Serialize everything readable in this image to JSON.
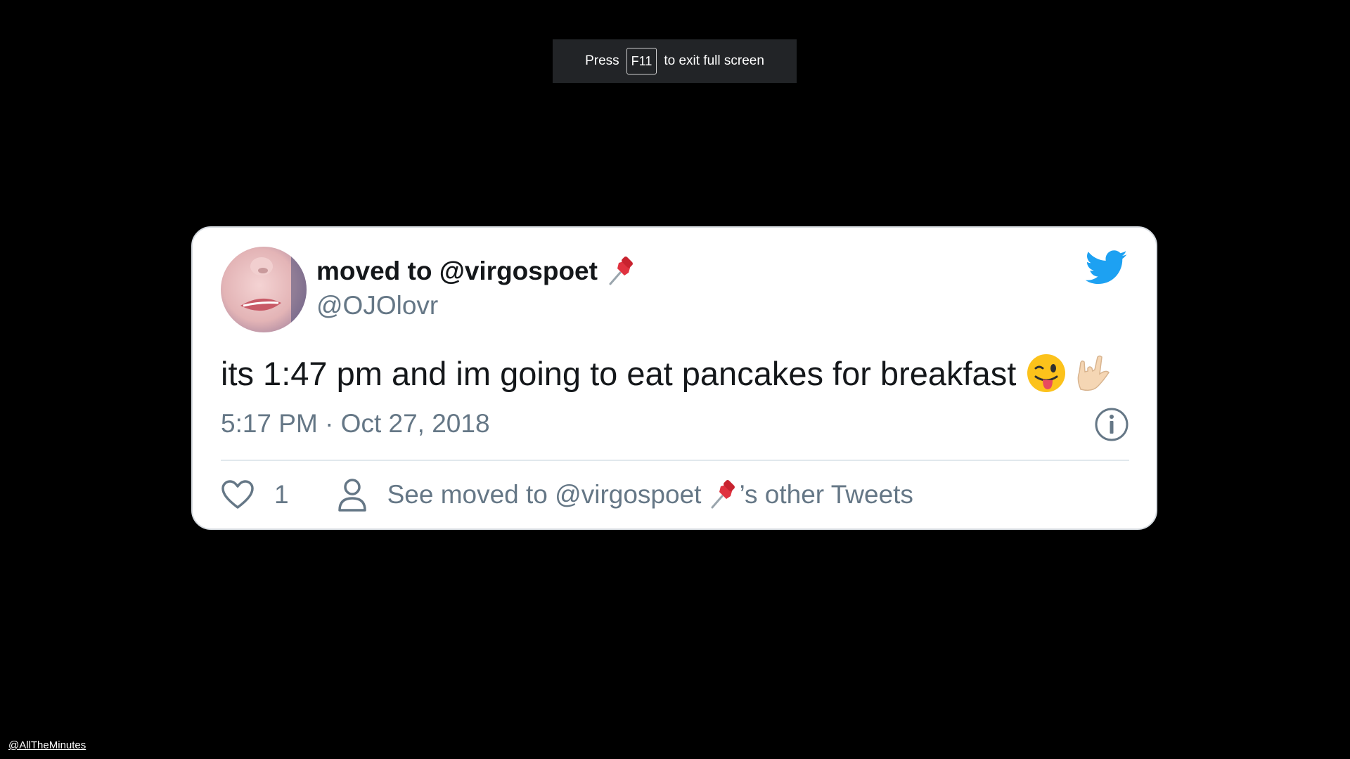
{
  "fullscreen_notice": {
    "prefix": "Press",
    "key": "F11",
    "suffix": "to exit full screen"
  },
  "tweet": {
    "display_name": "moved to @virgospoet",
    "display_name_emoji": "pushpin-icon",
    "handle": "@OJOlovr",
    "text": "its 1:47 pm and im going to eat pancakes for breakfast",
    "text_emojis": [
      "winking-tongue-face-icon",
      "love-you-gesture-icon"
    ],
    "timestamp": "5:17 PM · Oct 27, 2018",
    "like_count": "1",
    "other_tweets_prefix": "See moved to @virgospoet",
    "other_tweets_suffix": "’s other Tweets",
    "brand_color": "#1da1f2",
    "text_color": "#14171a",
    "secondary_color": "#657786"
  },
  "watermark": "@AllTheMinutes"
}
